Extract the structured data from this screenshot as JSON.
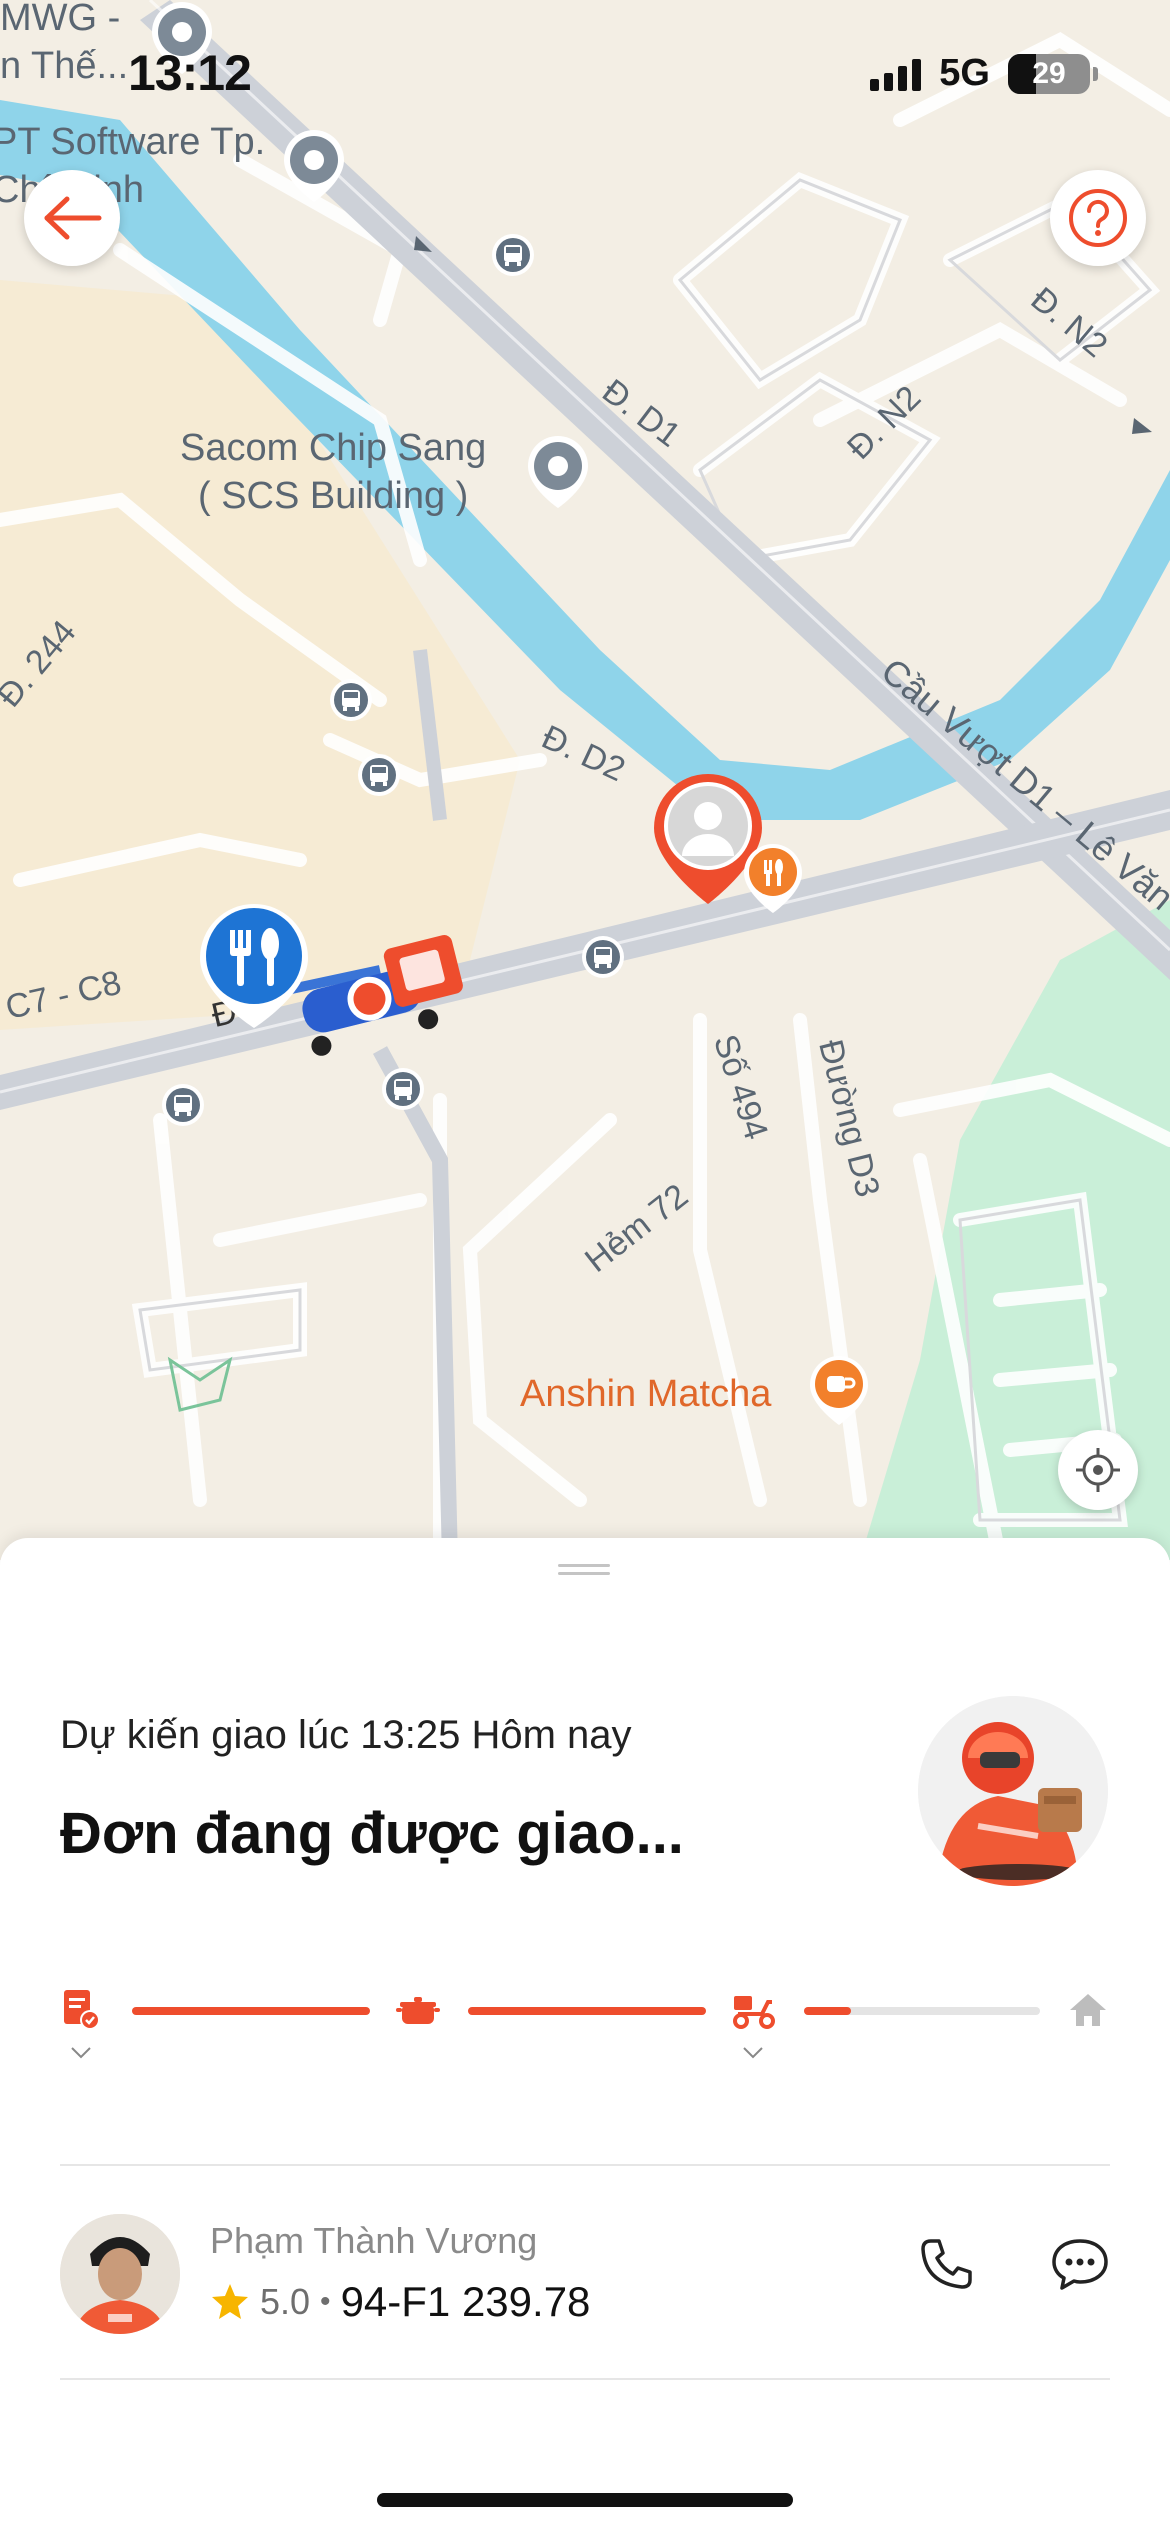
{
  "status_bar": {
    "time": "13:12",
    "network": "5G",
    "battery": "29"
  },
  "map": {
    "poi_labels": [
      {
        "id": "mwg",
        "text": "MWG -\nn Thế..."
      },
      {
        "id": "fpt",
        "text": "PT Software Tp.\nChí Minh"
      },
      {
        "id": "sacom",
        "text": "Sacom Chip Sang\n( SCS Building )"
      },
      {
        "id": "anshin",
        "text": "Anshin Matcha"
      }
    ],
    "road_labels": [
      {
        "id": "d1",
        "text": "Đ. D1"
      },
      {
        "id": "n2a",
        "text": "Đ. N2"
      },
      {
        "id": "n2b",
        "text": "Đ. N2"
      },
      {
        "id": "d244",
        "text": "Đ. 244"
      },
      {
        "id": "d2",
        "text": "Đ. D2"
      },
      {
        "id": "cauvuot",
        "text": "Cầu Vượt D1 – Lê Văn"
      },
      {
        "id": "c7c8",
        "text": "C7 - C8"
      },
      {
        "id": "d_small",
        "text": "Đ"
      },
      {
        "id": "so494",
        "text": "Số 494"
      },
      {
        "id": "duongd3",
        "text": "Đường D3"
      },
      {
        "id": "hem72",
        "text": "Hẻm 72"
      }
    ],
    "icons": {
      "back": "arrow-left-icon",
      "help": "question-icon",
      "locate": "crosshair-icon"
    },
    "colors": {
      "accent": "#ee4d2d",
      "water": "#8fd4ea",
      "park": "#c9efd8",
      "road": "#c9ced6",
      "restaurant_pin": "#1e74d4"
    }
  },
  "order": {
    "eta_text": "Dự kiến giao lúc 13:25 Hôm nay",
    "status_text": "Đơn đang được giao...",
    "progress": {
      "steps": [
        "order-confirmed-icon",
        "cooking-pot-icon",
        "delivery-scooter-icon",
        "home-icon"
      ],
      "completed_segments": 2,
      "current_segment_fraction": 0.2
    }
  },
  "driver": {
    "name": "Phạm Thành Vương",
    "rating": "5.0",
    "separator": "•",
    "plate": "94-F1 239.78"
  }
}
